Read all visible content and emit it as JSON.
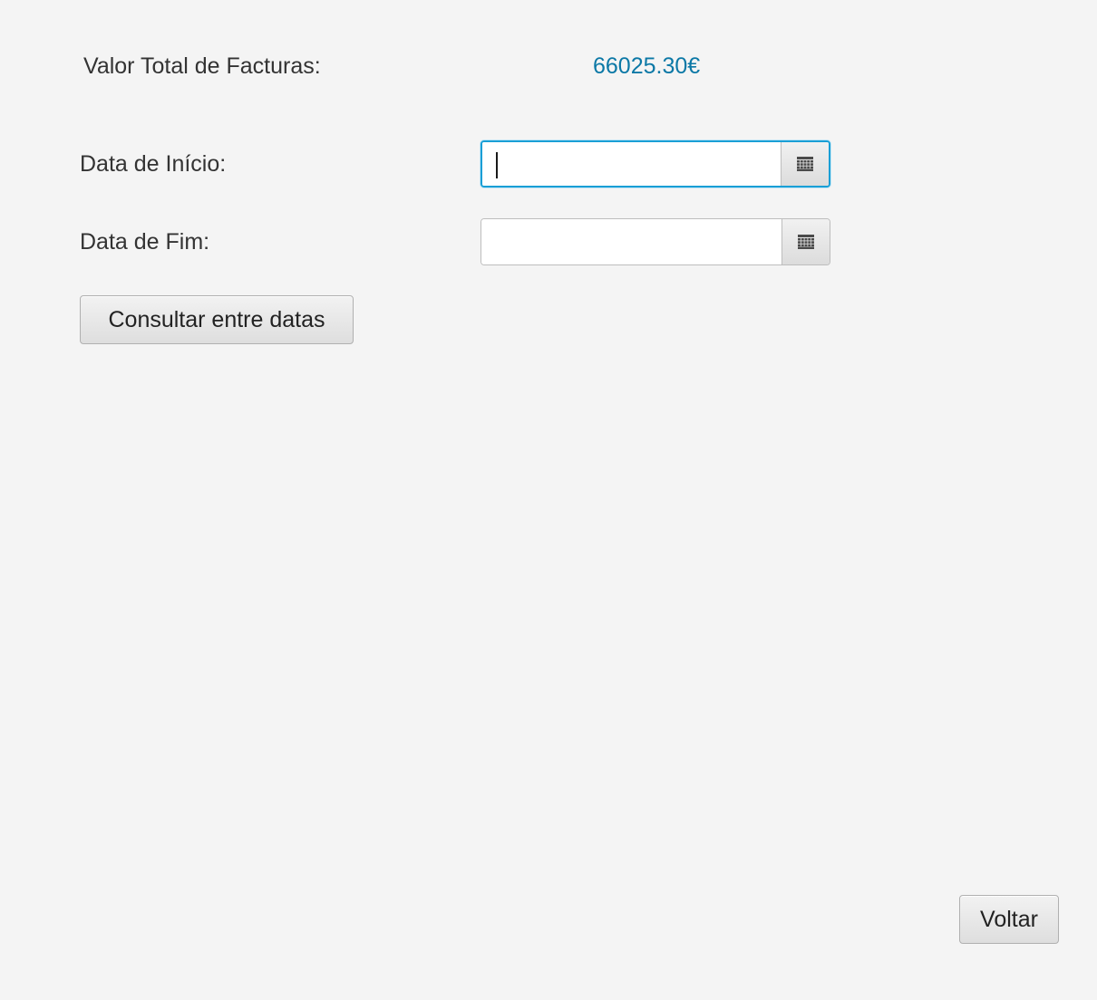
{
  "summary": {
    "total_label": "Valor Total de Facturas:",
    "total_value": "66025.30€"
  },
  "form": {
    "start_label": "Data de Início:",
    "start_value": "",
    "end_label": "Data de Fim:",
    "end_value": "",
    "calendar_icon": "calendar-icon",
    "query_button": "Consultar entre datas"
  },
  "footer": {
    "back_button": "Voltar"
  },
  "colors": {
    "background": "#f4f4f4",
    "total_value": "#0b78a6",
    "focus_border": "#1a9fd6"
  }
}
